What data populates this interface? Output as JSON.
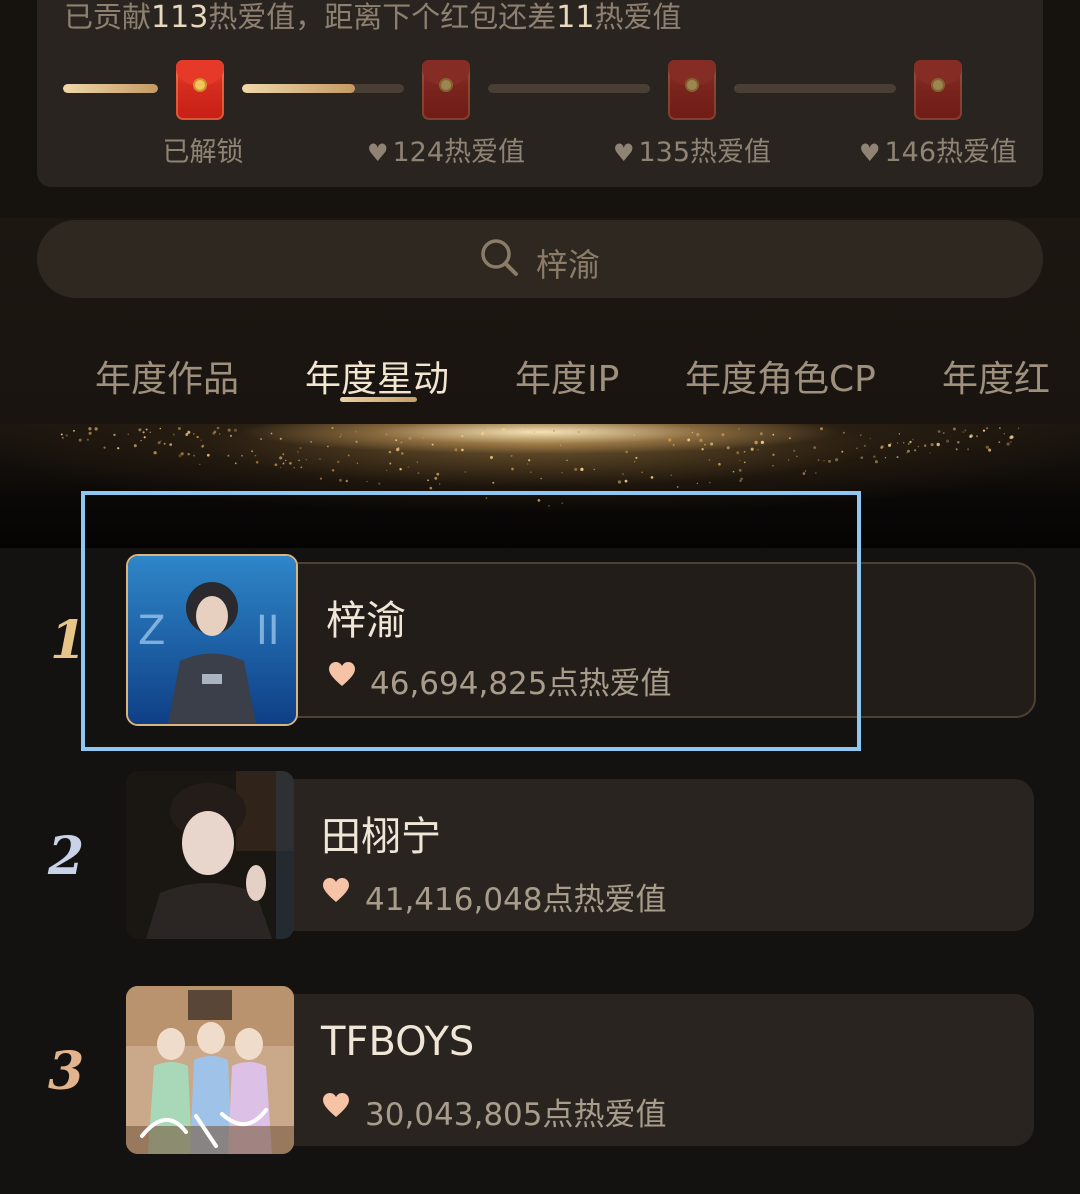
{
  "reward": {
    "contrib_prefix": "已贡献",
    "contrib_value": "113",
    "contrib_middle": "热爱值，距离下个红包还差",
    "contrib_remaining": "11",
    "contrib_suffix": "热爱值",
    "progress_fill": [
      1.0,
      0.7,
      0.0,
      0.0
    ],
    "envelopes": [
      {
        "label": "已解锁",
        "unlocked": true
      },
      {
        "label": "124热爱值",
        "unlocked": false
      },
      {
        "label": "135热爱值",
        "unlocked": false
      },
      {
        "label": "146热爱值",
        "unlocked": false
      }
    ]
  },
  "search": {
    "text": "梓渝",
    "icon": "search-icon"
  },
  "tabs": [
    {
      "label": "年度作品",
      "active": false
    },
    {
      "label": "年度星动",
      "active": true
    },
    {
      "label": "年度IP",
      "active": false
    },
    {
      "label": "年度角色CP",
      "active": false
    },
    {
      "label": "年度红",
      "active": false
    }
  ],
  "ranking": [
    {
      "rank": "1",
      "name": "梓渝",
      "score": "46,694,825点热爱值",
      "rank_color": "#e7c589"
    },
    {
      "rank": "2",
      "name": "田栩宁",
      "score": "41,416,048点热爱值",
      "rank_color": "#c9d2e6"
    },
    {
      "rank": "3",
      "name": "TFBOYS",
      "score": "30,043,805点热爱值",
      "rank_color": "#e2b48d"
    }
  ],
  "colors": {
    "accent_gold": "#e7c589",
    "highlight_box": "#8ec8f2",
    "envelope_red": "#d42c1e"
  }
}
